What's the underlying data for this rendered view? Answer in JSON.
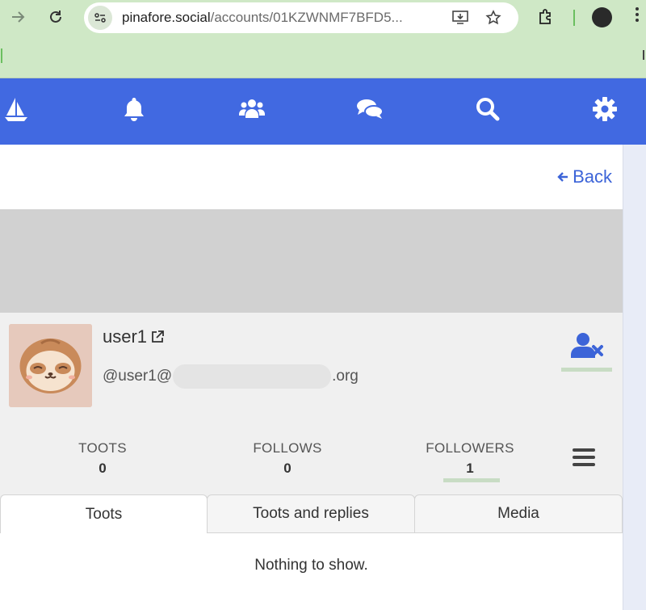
{
  "browser": {
    "url_host": "pinafore.social",
    "url_path": "/accounts/01KZWNMF7BFD5..."
  },
  "nav": {
    "items": [
      {
        "icon": "sailboat-icon"
      },
      {
        "icon": "bell-icon"
      },
      {
        "icon": "users-icon"
      },
      {
        "icon": "chat-icon"
      },
      {
        "icon": "search-icon"
      },
      {
        "icon": "gear-icon"
      }
    ],
    "accent": "#4169e1"
  },
  "back_label": "Back",
  "profile": {
    "display_name": "user1",
    "handle_prefix": "@user1@",
    "handle_suffix": ".org",
    "follow_icon": "user-unfollow-icon"
  },
  "stats": {
    "toots_label": "TOOTS",
    "toots_value": "0",
    "follows_label": "FOLLOWS",
    "follows_value": "0",
    "followers_label": "FOLLOWERS",
    "followers_value": "1"
  },
  "tabs": [
    {
      "label": "Toots",
      "active": true
    },
    {
      "label": "Toots and replies",
      "active": false
    },
    {
      "label": "Media",
      "active": false
    }
  ],
  "empty_message": "Nothing to show."
}
